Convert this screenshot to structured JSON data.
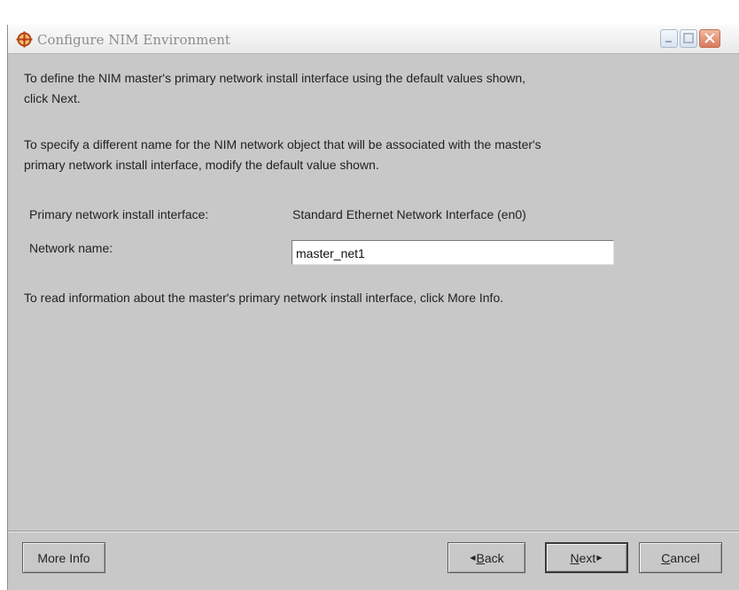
{
  "window": {
    "title": "Configure NIM Environment",
    "icon": "nim-target-icon",
    "controls": [
      "minimize-icon",
      "maximize-icon",
      "close-icon"
    ]
  },
  "content": {
    "paragraph1_line1": "To define the NIM master's primary network install interface using the default values shown,",
    "paragraph1_line2": "click Next.",
    "paragraph2_line1": "To specify a different name for the NIM network object that will be associated with the master's",
    "paragraph2_line2": "primary network install interface, modify the default value shown.",
    "interface_label": "Primary network install interface:",
    "interface_value": "Standard Ethernet Network Interface (en0)",
    "network_name_label": "Network name:",
    "network_name_value": "master_net1",
    "paragraph3": "To read information about the master's primary network install interface, click More Info."
  },
  "buttons": {
    "more_info": "More Info",
    "back_mnemonic": "B",
    "back_rest": "ack",
    "next_mnemonic": "N",
    "next_rest": "ext",
    "cancel_mnemonic": "C",
    "cancel_rest": "ancel"
  },
  "colors": {
    "dialog_bg": "#c8c8c8",
    "title_text": "#8c8c8c",
    "icon_accent": "#c0501f"
  }
}
